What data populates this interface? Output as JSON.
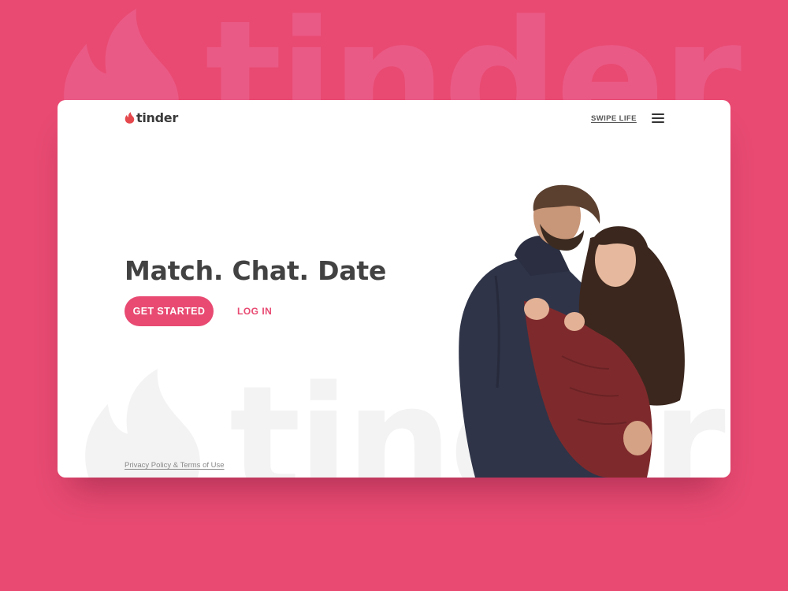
{
  "brand": {
    "name": "tinder"
  },
  "nav": {
    "swipe_life": "SWIPE LIFE",
    "menu_icon": "hamburger-menu-icon"
  },
  "hero": {
    "title": "Match. Chat. Date",
    "primary_button": "GET STARTED",
    "login_button": "LOG IN"
  },
  "footer": {
    "legal_link": "Privacy Policy & Terms of Use"
  },
  "colors": {
    "brand_pink": "#e84a72",
    "logo_flame": "#e5484d",
    "background": "#e84a72",
    "card": "#ffffff"
  }
}
